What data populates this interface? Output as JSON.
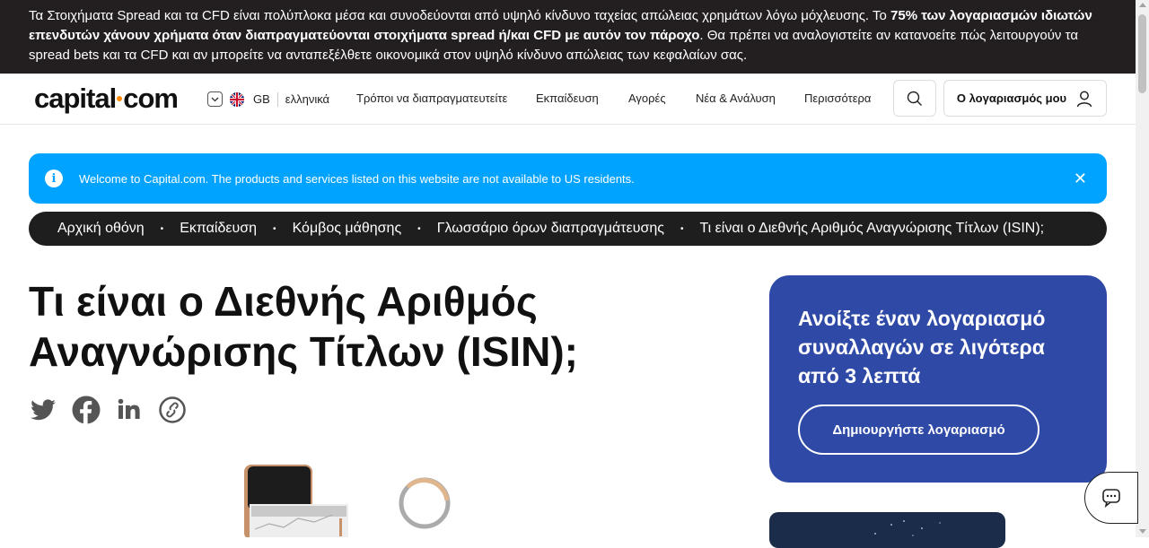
{
  "risk_banner": {
    "part1": "Τα Στοιχήματα Spread και τα CFD είναι πολύπλοκα μέσα και συνοδεύονται από υψηλό κίνδυνο ταχείας απώλειας χρημάτων λόγω μόχλευσης. Το ",
    "bold": "75% των λογαριασμών ιδιωτών επενδυτών χάνουν χρήματα όταν διαπραγματεύονται στοιχήματα spread ή/και CFD με αυτόν τον πάροχο",
    "part2": ". Θα πρέπει να αναλογιστείτε αν κατανοείτε πώς λειτουργούν τα spread bets και τα CFD και αν μπορείτε να ανταπεξέλθετε οικονομικά στον υψηλό κίνδυνο απώλειας των κεφαλαίων σας."
  },
  "header": {
    "logo_left": "capital",
    "logo_right": "com",
    "region": "GB",
    "language": "ελληνικά",
    "nav": [
      "Τρόποι να διαπραγματευτείτε",
      "Εκπαίδευση",
      "Αγορές",
      "Νέα & Ανάλυση",
      "Περισσότερα"
    ],
    "account_label": "Ο λογαριασμός μου"
  },
  "info_bar": {
    "message": "Welcome to Capital.com. The products and services listed on this website are not available to US residents.",
    "info_glyph": "i",
    "close_glyph": "✕"
  },
  "breadcrumb": {
    "items": [
      "Αρχική οθόνη",
      "Εκπαίδευση",
      "Κόμβος μάθησης",
      "Γλωσσάριο όρων διαπραγμάτευσης",
      "Τι είναι ο Διεθνής Αριθμός Αναγνώρισης Τίτλων (ISIN);"
    ],
    "separator": "•"
  },
  "article": {
    "title": "Τι είναι ο Διεθνής Αριθμός Αναγνώρισης Τίτλων (ISIN);",
    "share_icons": [
      "twitter-icon",
      "facebook-icon",
      "linkedin-icon",
      "copy-link-icon"
    ]
  },
  "cta": {
    "title": "Ανοίξτε έναν λογαριασμό συναλλαγών σε λιγότερα από 3 λεπτά",
    "button": "Δημιουργήστε λογαριασμό"
  },
  "colors": {
    "banner_bg": "#231f20",
    "info_bar": "#00a3ff",
    "breadcrumb_bg": "#1e1e1e",
    "cta_bg": "#2f4aa6",
    "logo_dot": "#ff8c00"
  }
}
